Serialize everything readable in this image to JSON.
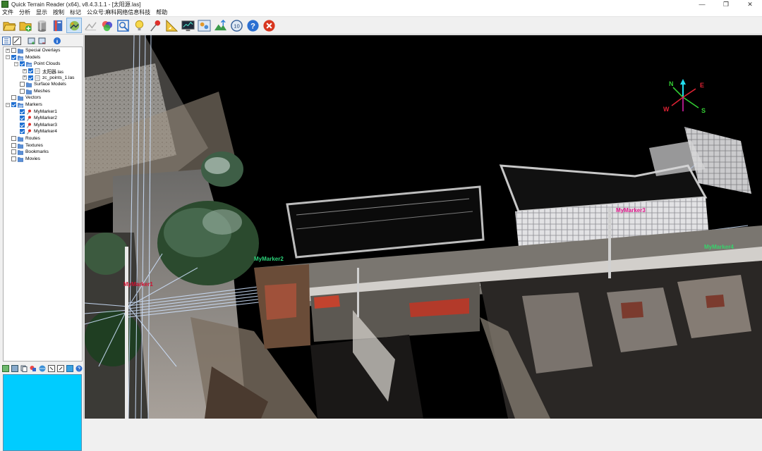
{
  "window": {
    "title": "Quick Terrain Reader (x64), v8.4.3.1.1 - [太阳源.las]",
    "minimize_glyph": "—",
    "maximize_glyph": "❐",
    "close_glyph": "✕"
  },
  "menu": [
    "文件",
    "分析",
    "显示",
    "按制",
    "标记",
    "公众号:麻科网络信息科技",
    "帮助"
  ],
  "toolbar": {
    "buttons": [
      {
        "name": "open-folder",
        "icon": "open-folder-icon"
      },
      {
        "name": "add-data",
        "icon": "add-data-icon"
      },
      {
        "name": "cylinder",
        "icon": "cylinder-icon"
      },
      {
        "name": "layers",
        "icon": "layers-icon"
      },
      {
        "name": "navigate",
        "icon": "navigate-icon",
        "active": true
      },
      {
        "name": "profile",
        "icon": "profile-icon"
      },
      {
        "name": "color-rgb",
        "icon": "color-rgb-icon"
      },
      {
        "name": "zoom-extent",
        "icon": "zoom-extent-icon"
      },
      {
        "name": "lighting",
        "icon": "bulb-icon"
      },
      {
        "name": "pin",
        "icon": "pin-icon"
      },
      {
        "name": "measure",
        "icon": "measure-icon"
      },
      {
        "name": "monitor",
        "icon": "monitor-icon"
      },
      {
        "name": "screenshot",
        "icon": "image-icon"
      },
      {
        "name": "terrain",
        "icon": "terrain-icon"
      },
      {
        "name": "timer",
        "icon": "clock-icon",
        "label": "10"
      },
      {
        "name": "help",
        "icon": "help-icon",
        "label": "?"
      },
      {
        "name": "exit",
        "icon": "exit-icon"
      }
    ]
  },
  "tree": [
    {
      "level": 0,
      "expander": "+",
      "checkbox": false,
      "icon": "folder",
      "label": "Special Overlays"
    },
    {
      "level": 0,
      "expander": "−",
      "checkbox": true,
      "icon": "folder-open",
      "label": "Models"
    },
    {
      "level": 1,
      "expander": "−",
      "checkbox": true,
      "icon": "folder-open",
      "label": "Point Clouds"
    },
    {
      "level": 2,
      "expander": "+",
      "checkbox": true,
      "icon": "file",
      "label": "太阳器.las"
    },
    {
      "level": 2,
      "expander": "+",
      "checkbox": true,
      "icon": "file",
      "label": "zc_points_1.las"
    },
    {
      "level": 1,
      "expander": "",
      "checkbox": false,
      "icon": "folder",
      "label": "Surface Models"
    },
    {
      "level": 1,
      "expander": "",
      "checkbox": false,
      "icon": "folder",
      "label": "Meshes"
    },
    {
      "level": 0,
      "expander": "",
      "checkbox": false,
      "icon": "folder",
      "label": "Vectors"
    },
    {
      "level": 0,
      "expander": "−",
      "checkbox": true,
      "icon": "folder-open",
      "label": "Markers"
    },
    {
      "level": 1,
      "expander": "",
      "checkbox": true,
      "icon": "pin",
      "label": "MyMarker1"
    },
    {
      "level": 1,
      "expander": "",
      "checkbox": true,
      "icon": "pin",
      "label": "MyMarker2"
    },
    {
      "level": 1,
      "expander": "",
      "checkbox": true,
      "icon": "pin",
      "label": "MyMarker3"
    },
    {
      "level": 1,
      "expander": "",
      "checkbox": true,
      "icon": "pin",
      "label": "MyMarker4"
    },
    {
      "level": 0,
      "expander": "",
      "checkbox": false,
      "icon": "folder",
      "label": "Routes"
    },
    {
      "level": 0,
      "expander": "",
      "checkbox": false,
      "icon": "folder",
      "label": "Textures"
    },
    {
      "level": 0,
      "expander": "",
      "checkbox": false,
      "icon": "folder",
      "label": "Bookmarks"
    },
    {
      "level": 0,
      "expander": "",
      "checkbox": false,
      "icon": "folder",
      "label": "Movies"
    }
  ],
  "markers": [
    {
      "name": "MyMarker1",
      "color": "#d01030"
    },
    {
      "name": "MyMarker2",
      "color": "#2bd37a"
    },
    {
      "name": "MyMarker3",
      "color": "#e0158a"
    },
    {
      "name": "MyMarker4",
      "color": "#36d36b"
    }
  ],
  "compass": {
    "n": "N",
    "e": "E",
    "w": "W",
    "s": "S"
  },
  "colors": {
    "preview": "#00ccff",
    "viewport": "#000000",
    "selection": "#1f6fd1"
  }
}
